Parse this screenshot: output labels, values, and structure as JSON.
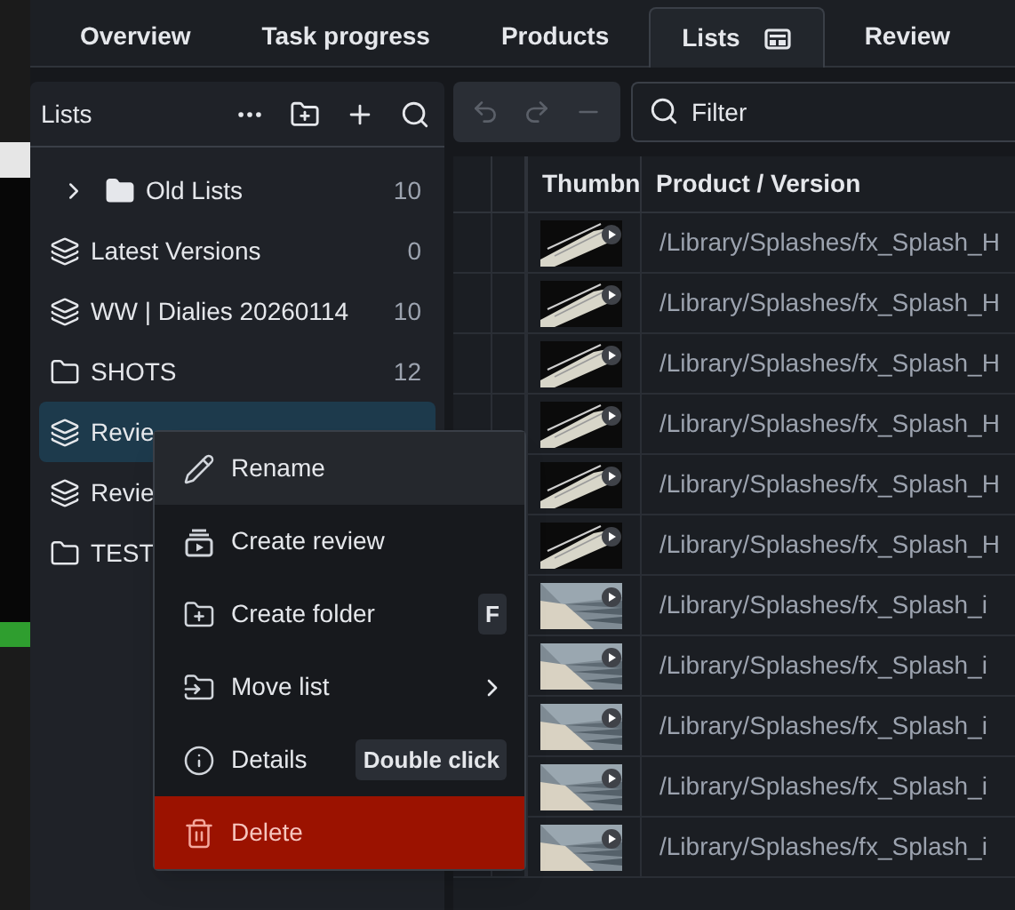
{
  "tabs": [
    {
      "label": "Overview",
      "selected": false
    },
    {
      "label": "Task progress",
      "selected": false
    },
    {
      "label": "Products",
      "selected": false
    },
    {
      "label": "Lists",
      "selected": true
    },
    {
      "label": "Review",
      "selected": false
    }
  ],
  "lists_panel": {
    "title": "Lists",
    "items": [
      {
        "kind": "folder",
        "label": "Old Lists",
        "count": "10",
        "selected": false,
        "collapsible": true
      },
      {
        "kind": "list",
        "label": "Latest Versions",
        "count": "0",
        "selected": false
      },
      {
        "kind": "list",
        "label": "WW | Dialies 20260114",
        "count": "10",
        "selected": false
      },
      {
        "kind": "folder",
        "label": "SHOTS",
        "count": "12",
        "selected": false
      },
      {
        "kind": "list",
        "label": "Revie",
        "selected": true
      },
      {
        "kind": "list",
        "label": "Revie",
        "selected": false
      },
      {
        "kind": "folder",
        "label": "TEST",
        "selected": false
      }
    ]
  },
  "context_menu": [
    {
      "kind": "rename",
      "label": "Rename",
      "hovered": true
    },
    {
      "kind": "review",
      "label": "Create review",
      "hovered": false
    },
    {
      "kind": "folder",
      "label": "Create folder",
      "shortcut": "F",
      "hovered": false
    },
    {
      "kind": "move",
      "label": "Move list",
      "submenu": true,
      "hovered": false
    },
    {
      "kind": "info",
      "label": "Details",
      "shortcut": "Double click",
      "hovered": false
    },
    {
      "kind": "delete",
      "label": "Delete",
      "danger": true
    }
  ],
  "filter": {
    "placeholder": "Filter"
  },
  "table": {
    "columns": [
      "Thumbn",
      "Product / Version"
    ],
    "rows": [
      {
        "path": "/Library/Splashes/fx_Splash_H"
      },
      {
        "path": "/Library/Splashes/fx_Splash_H"
      },
      {
        "path": "/Library/Splashes/fx_Splash_H"
      },
      {
        "path": "/Library/Splashes/fx_Splash_H"
      },
      {
        "path": "/Library/Splashes/fx_Splash_H"
      },
      {
        "path": "/Library/Splashes/fx_Splash_H"
      },
      {
        "path": "/Library/Splashes/fx_Splash_i"
      },
      {
        "path": "/Library/Splashes/fx_Splash_i"
      },
      {
        "path": "/Library/Splashes/fx_Splash_i"
      },
      {
        "path": "/Library/Splashes/fx_Splash_i"
      },
      {
        "path": "/Library/Splashes/fx_Splash_i"
      }
    ]
  }
}
